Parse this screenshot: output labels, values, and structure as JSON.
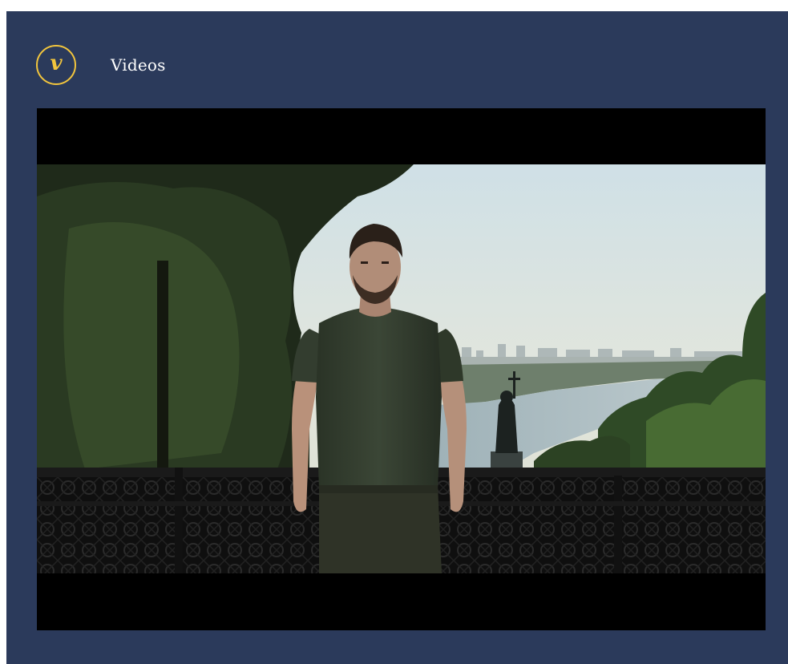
{
  "header": {
    "logo_letter": "v",
    "title": "Videos"
  },
  "video": {
    "thumbnail": "video-thumbnail-man-on-terrace"
  },
  "colors": {
    "frame_bg": "#2b3a5b",
    "logo_accent": "#f2c53d",
    "title_text": "#ffffff",
    "player_bg": "#000000"
  }
}
